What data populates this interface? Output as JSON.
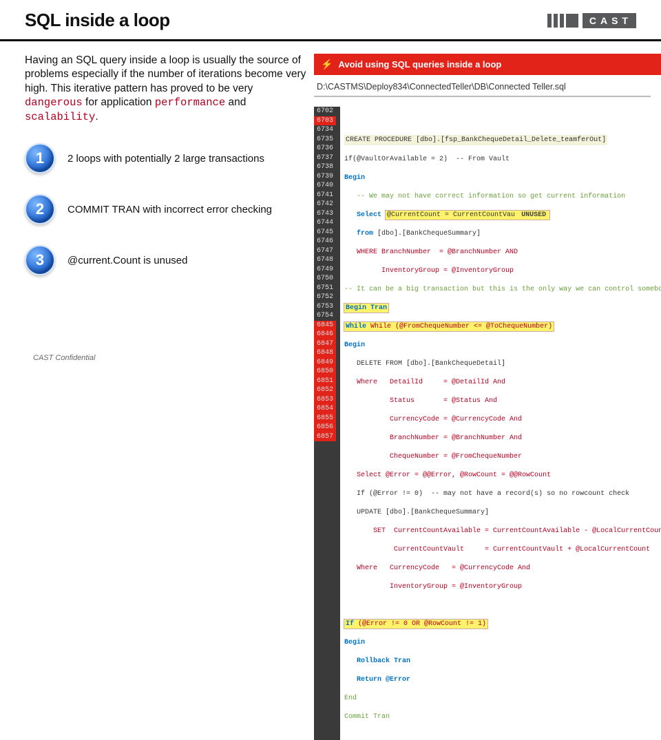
{
  "header": {
    "title": "SQL inside a loop",
    "logo_text": "CAST"
  },
  "paragraph": {
    "p1": "Having an SQL query inside a loop is usually the source of problems especially if the number of iterations become very high. This iterative pattern has proved to be very ",
    "danger": "dangerous",
    "p2": " for application ",
    "perf": "performance",
    "p3": " and ",
    "scal": "scalability",
    "p4": "."
  },
  "issues": [
    {
      "num": "1",
      "text": "2 loops with potentially 2 large transactions"
    },
    {
      "num": "2",
      "text": "COMMIT TRAN with incorrect error checking"
    },
    {
      "num": "3",
      "text": "@current.Count is unused"
    }
  ],
  "footer": "CAST Confidential",
  "rule": {
    "title": "Avoid using SQL queries inside a loop"
  },
  "filepath": "D:\\CASTMS\\Deploy834\\ConnectedTeller\\DB\\Connected Teller.sql",
  "gutter_lines": [
    "6702",
    "6703",
    "6734",
    "6735",
    "6736",
    "6737",
    "6738",
    "6739",
    "6740",
    "6741",
    "6742",
    "6743",
    "6744",
    "6745",
    "6746",
    "6747",
    "6748",
    "6749",
    "6750",
    "6751",
    "6752",
    "6753",
    "6754",
    "6845",
    "6846",
    "6847",
    "6848",
    "6849",
    "6850",
    "6851",
    "6852",
    "6853",
    "6854",
    "6855",
    "6856",
    "6857"
  ],
  "code": {
    "l1": "CREATE PROCEDURE [dbo].[fsp_BankChequeDetail_Delete_teamferOut]",
    "l2a": "if(@VaultOrAvailable = 2)  -- From Vault",
    "l2b": "Begin",
    "l3": "   -- We may not have correct information so get current information",
    "l4a": "   Select ",
    "l4b": "@CurrentCount = CurrentCountVau",
    "l4c": "UNUSED",
    "l5": "   from ",
    "l5b": "[dbo].[BankChequeSummary]",
    "l6": "   WHERE BranchNumber  = @BranchNumber AND",
    "l7": "         InventoryGroup = @InventoryGroup",
    "l8": "-- It can be a big transaction but this is the only way we can control somebody else inserting similar cheques",
    "l9": "Begin Tran",
    "l10": "While (@FromChequeNumber <= @ToChequeNumber)",
    "l11": "Begin",
    "l12": "   DELETE FROM [dbo].[BankChequeDetail]",
    "l13": "   Where   DetailId     = @DetailId And",
    "l14": "           Status       = @Status And",
    "l15": "           CurrencyCode = @CurrencyCode And",
    "l16": "           BranchNumber = @BranchNumber And",
    "l17": "           ChequeNumber = @FromChequeNumber",
    "l18": "   Select @Error = @@Error, @RowCount = @@RowCount",
    "l19": "   If (@Error != 0)  -- may not have a record(s) so no rowcount check",
    "l20": "   UPDATE [dbo].[BankChequeSummary]",
    "l21": "       SET  CurrentCountAvailable = CurrentCountAvailable - @LocalCurrentCount,",
    "l22": "            CurrentCountVault     = CurrentCountVault + @LocalCurrentCount",
    "l23": "   Where   CurrencyCode   = @CurrencyCode And",
    "l24": "           InventoryGroup = @InventoryGroup",
    "l25a": "If ",
    "l25b": "(@Error != 0 OR @RowCount != 1)",
    "l26": "Begin",
    "l27": "   Rollback Tran",
    "l28": "   Return @Error",
    "l29": "End",
    "l30": "Commit Tran"
  }
}
